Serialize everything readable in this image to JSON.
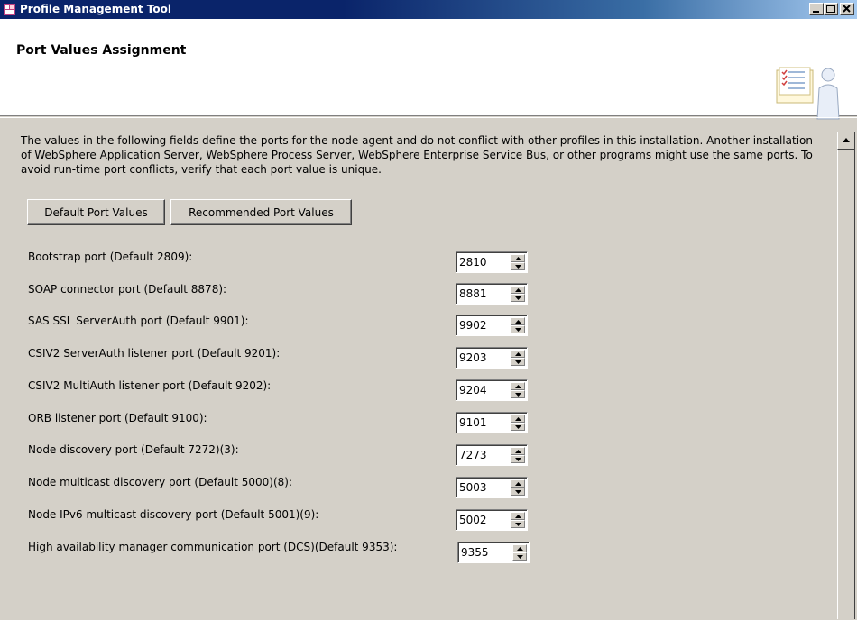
{
  "window": {
    "title": "Profile Management Tool"
  },
  "header": {
    "title": "Port Values Assignment"
  },
  "description": "The values in the following fields define the ports for the node agent and do not conflict with other profiles in this installation. Another installation of WebSphere Application Server, WebSphere Process Server, WebSphere Enterprise Service Bus, or other programs might use the same ports. To avoid run-time port conflicts, verify that each port value is unique.",
  "buttons": {
    "default_ports": "Default Port Values",
    "recommended_ports": "Recommended Port Values"
  },
  "ports": [
    {
      "label": "Bootstrap port (Default 2809):",
      "value": "2810"
    },
    {
      "label": "SOAP connector port (Default 8878):",
      "value": "8881"
    },
    {
      "label": "SAS SSL ServerAuth port (Default 9901):",
      "value": "9902"
    },
    {
      "label": "CSIV2 ServerAuth listener port (Default 9201):",
      "value": "9203"
    },
    {
      "label": "CSIV2 MultiAuth listener port (Default 9202):",
      "value": "9204"
    },
    {
      "label": "ORB listener port (Default 9100):",
      "value": "9101"
    },
    {
      "label": "Node discovery port (Default 7272)(3):",
      "value": "7273"
    },
    {
      "label": "Node multicast discovery port (Default 5000)(8):",
      "value": "5003"
    },
    {
      "label": "Node IPv6 multicast discovery port (Default 5001)(9):",
      "value": "5002"
    },
    {
      "label": "High availability manager communication port (DCS)(Default 9353):",
      "value": "9355"
    }
  ],
  "icons": {
    "app": "profile-management-icon",
    "header": "checklist-person-icon",
    "minimize": "minimize-icon",
    "maximize": "maximize-icon",
    "close": "close-icon",
    "scroll_up": "arrow-up-icon"
  },
  "colors": {
    "titlebar": "#0a246a",
    "face": "#d4d0c8"
  }
}
